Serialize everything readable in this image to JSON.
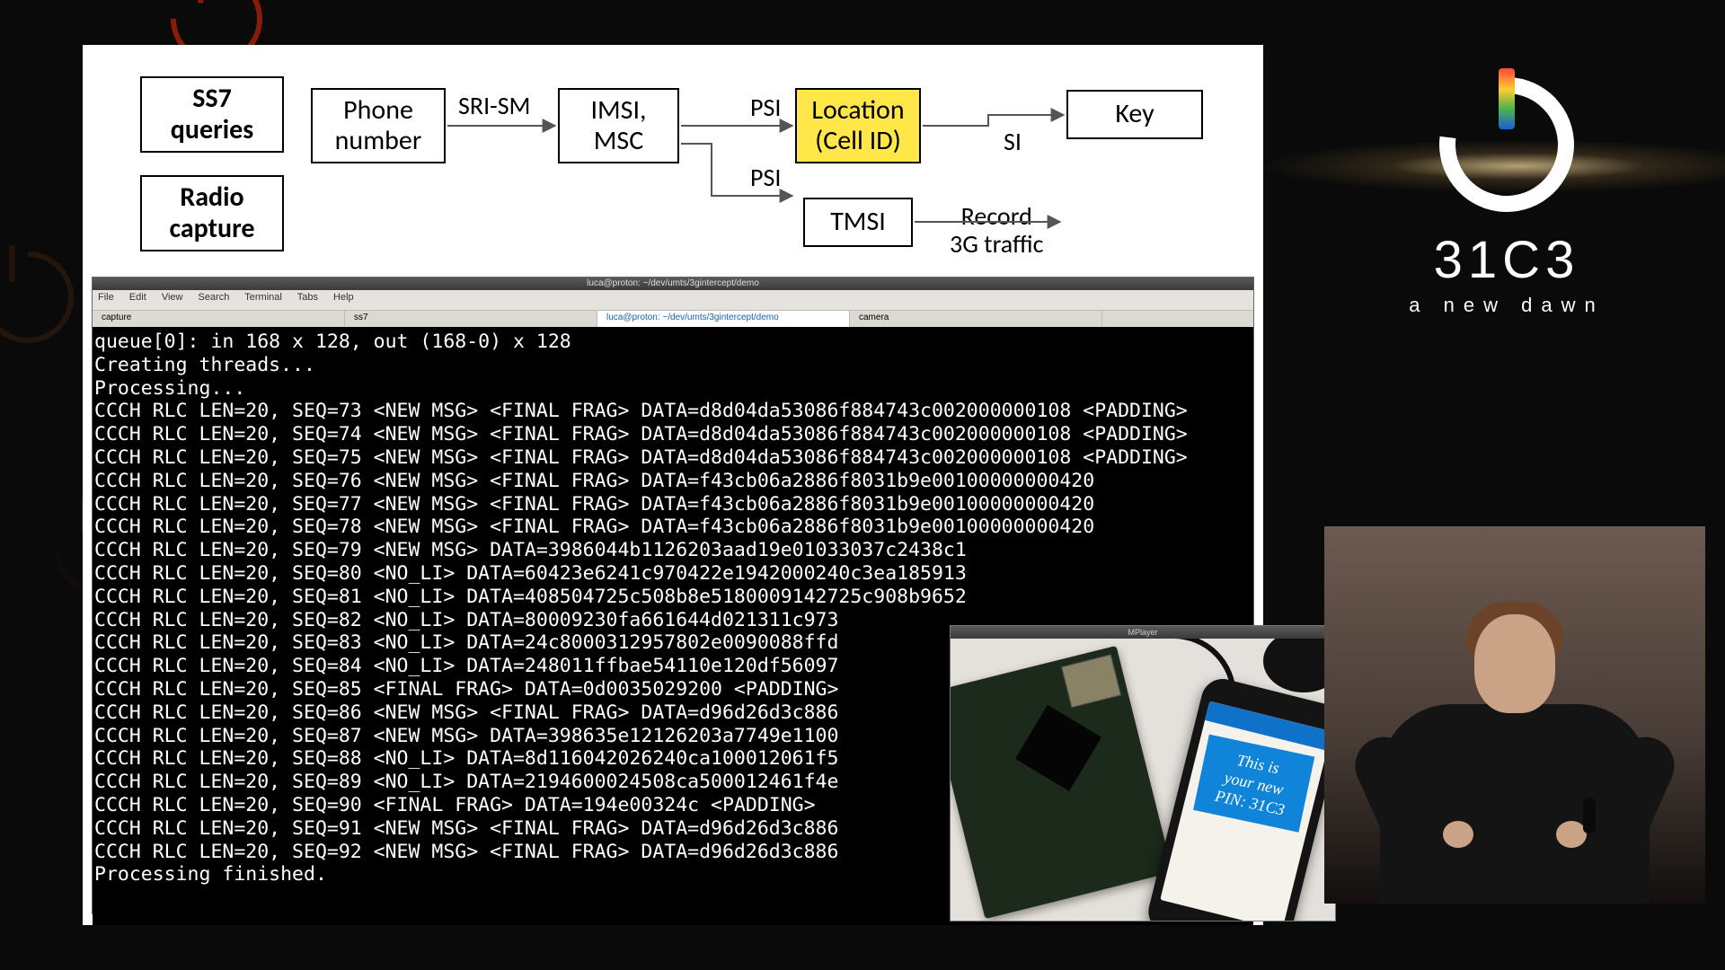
{
  "diagram": {
    "ss7": "SS7 queries",
    "radio": "Radio capture",
    "phone": "Phone number",
    "imsi": "IMSI, MSC",
    "location": "Location (Cell ID)",
    "tmsi": "TMSI",
    "key": "Key",
    "srism": "SRI-SM",
    "psi1": "PSI",
    "psi2": "PSI",
    "si": "SI",
    "record": "Record 3G traffic"
  },
  "window": {
    "title": "luca@proton: ~/dev/umts/3gintercept/demo",
    "menu": [
      "File",
      "Edit",
      "View",
      "Search",
      "Terminal",
      "Tabs",
      "Help"
    ],
    "tabs": [
      "capture",
      "ss7",
      "luca@proton: ~/dev/umts/3gintercept/demo",
      "camera"
    ],
    "player_title": "MPlayer"
  },
  "terminal_lines": [
    "queue[0]: in 168 x 128, out (168-0) x 128",
    "Creating threads...",
    "Processing...",
    "CCCH RLC LEN=20, SEQ=73 <NEW MSG> <FINAL FRAG> DATA=d8d04da53086f884743c002000000108 <PADDING>",
    "CCCH RLC LEN=20, SEQ=74 <NEW MSG> <FINAL FRAG> DATA=d8d04da53086f884743c002000000108 <PADDING>",
    "CCCH RLC LEN=20, SEQ=75 <NEW MSG> <FINAL FRAG> DATA=d8d04da53086f884743c002000000108 <PADDING>",
    "CCCH RLC LEN=20, SEQ=76 <NEW MSG> <FINAL FRAG> DATA=f43cb06a2886f8031b9e00100000000420",
    "CCCH RLC LEN=20, SEQ=77 <NEW MSG> <FINAL FRAG> DATA=f43cb06a2886f8031b9e00100000000420",
    "CCCH RLC LEN=20, SEQ=78 <NEW MSG> <FINAL FRAG> DATA=f43cb06a2886f8031b9e00100000000420",
    "CCCH RLC LEN=20, SEQ=79 <NEW MSG> DATA=3986044b1126203aad19e01033037c2438c1",
    "CCCH RLC LEN=20, SEQ=80 <NO_LI> DATA=60423e6241c970422e1942000240c3ea185913",
    "CCCH RLC LEN=20, SEQ=81 <NO_LI> DATA=408504725c508b8e5180009142725c908b9652",
    "CCCH RLC LEN=20, SEQ=82 <NO_LI> DATA=80009230fa661644d021311c973",
    "CCCH RLC LEN=20, SEQ=83 <NO_LI> DATA=24c8000312957802e0090088ffd",
    "CCCH RLC LEN=20, SEQ=84 <NO_LI> DATA=248011ffbae54110e120df56097",
    "CCCH RLC LEN=20, SEQ=85 <FINAL FRAG> DATA=0d0035029200 <PADDING>",
    "CCCH RLC LEN=20, SEQ=86 <NEW MSG> <FINAL FRAG> DATA=d96d26d3c886",
    "CCCH RLC LEN=20, SEQ=87 <NEW MSG> DATA=398635e12126203a7749e1100",
    "CCCH RLC LEN=20, SEQ=88 <NO_LI> DATA=8d116042026240ca100012061f5",
    "CCCH RLC LEN=20, SEQ=89 <NO_LI> DATA=2194600024508ca500012461f4e",
    "CCCH RLC LEN=20, SEQ=90 <FINAL FRAG> DATA=194e00324c <PADDING>",
    "CCCH RLC LEN=20, SEQ=91 <NEW MSG> <FINAL FRAG> DATA=d96d26d3c886",
    "CCCH RLC LEN=20, SEQ=92 <NEW MSG> <FINAL FRAG> DATA=d96d26d3c886",
    "Processing finished."
  ],
  "phone": {
    "note_line1": "This is",
    "note_line2": "your new",
    "note_line3": "PIN: 31C3"
  },
  "brand": {
    "name": "31C3",
    "tag": "a new dawn"
  }
}
